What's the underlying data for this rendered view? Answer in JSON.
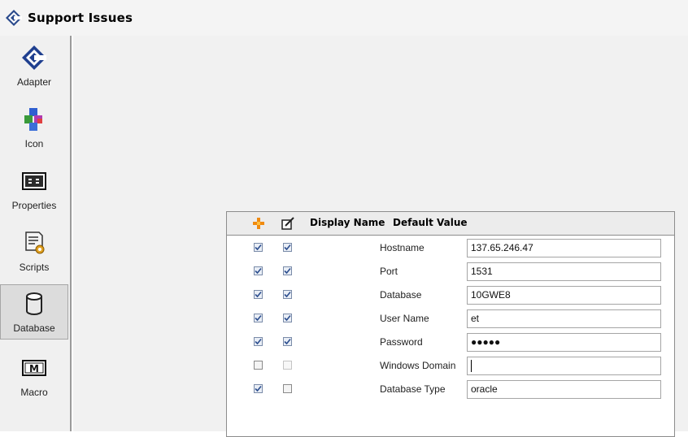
{
  "window": {
    "title": "Support Issues"
  },
  "sidebar": {
    "items": [
      {
        "label": "Adapter",
        "icon": "adapter-icon",
        "selected": false
      },
      {
        "label": "Icon",
        "icon": "icon-icon",
        "selected": false
      },
      {
        "label": "Properties",
        "icon": "properties-icon",
        "selected": false
      },
      {
        "label": "Scripts",
        "icon": "scripts-icon",
        "selected": false
      },
      {
        "label": "Database",
        "icon": "database-icon",
        "selected": true
      },
      {
        "label": "Macro",
        "icon": "macro-icon",
        "selected": false
      }
    ]
  },
  "table": {
    "headers": {
      "add_icon": "add-icon",
      "edit_icon": "edit-icon",
      "display_name": "Display Name",
      "default_value": "Default Value"
    },
    "rows": [
      {
        "included": true,
        "editable": true,
        "display_name": "Hostname",
        "default_value": "137.65.246.47"
      },
      {
        "included": true,
        "editable": true,
        "display_name": "Port",
        "default_value": "1531"
      },
      {
        "included": true,
        "editable": true,
        "display_name": "Database",
        "default_value": "10GWE8"
      },
      {
        "included": true,
        "editable": true,
        "display_name": "User Name",
        "default_value": "et"
      },
      {
        "included": true,
        "editable": true,
        "display_name": "Password",
        "default_value": "●●●●●"
      },
      {
        "included": false,
        "editable": false,
        "display_name": "Windows Domain",
        "default_value": ""
      },
      {
        "included": true,
        "editable": false,
        "display_name": "Database Type",
        "default_value": "oracle"
      }
    ]
  },
  "colors": {
    "sidebar_bg": "#f0f0f0",
    "content_bg": "#f1f1f1",
    "header_bg": "#ececec",
    "accent": "#1f3f8f"
  }
}
